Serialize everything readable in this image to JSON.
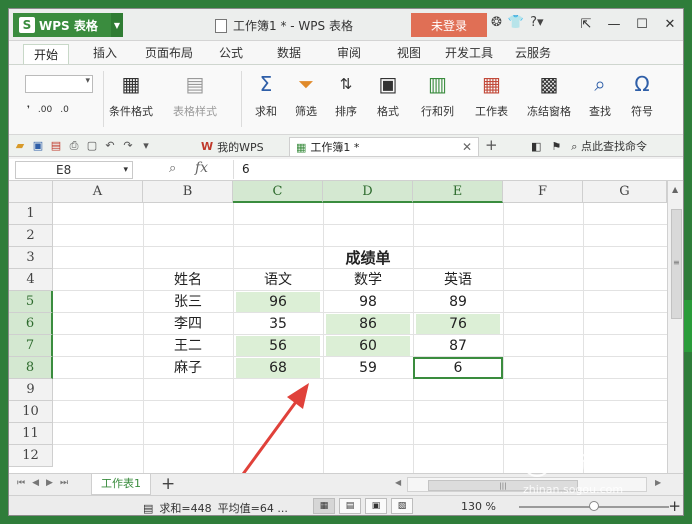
{
  "titlebar": {
    "app_name": "WPS 表格",
    "app_logo": "S",
    "doc_title": "工作簿1 * - WPS 表格",
    "login_label": "未登录",
    "icons": [
      "skin-icon",
      "shirt-icon",
      "help-icon"
    ],
    "help_glyph": "?",
    "window_controls": [
      "minimize-icon",
      "restore-icon",
      "close-icon"
    ]
  },
  "menu": {
    "tabs": [
      "开始",
      "插入",
      "页面布局",
      "公式",
      "数据",
      "审阅",
      "视图",
      "开发工具",
      "云服务"
    ],
    "active": "开始"
  },
  "ribbon": {
    "format_glyphs": [
      ".00",
      ".0"
    ],
    "buttons": [
      {
        "label": "条件格式",
        "icon": "conditional-format-icon"
      },
      {
        "label": "表格样式",
        "icon": "table-style-icon",
        "disabled": true
      },
      {
        "label": "求和",
        "icon": "sum-icon",
        "glyph": "Σ"
      },
      {
        "label": "筛选",
        "icon": "filter-icon"
      },
      {
        "label": "排序",
        "icon": "sort-icon"
      },
      {
        "label": "格式",
        "icon": "format-icon"
      },
      {
        "label": "行和列",
        "icon": "row-column-icon"
      },
      {
        "label": "工作表",
        "icon": "worksheet-icon"
      },
      {
        "label": "冻结窗格",
        "icon": "freeze-panes-icon"
      },
      {
        "label": "查找",
        "icon": "find-icon"
      },
      {
        "label": "符号",
        "icon": "symbol-icon",
        "glyph": "Ω"
      }
    ]
  },
  "quickbar": {
    "mywps_label": "我的WPS",
    "book_tab_label": "工作簿1 *",
    "search_label": "点此查找命令"
  },
  "formula_bar": {
    "name_box": "E8",
    "fx_label": "fx",
    "value": "6"
  },
  "grid": {
    "columns": [
      "A",
      "B",
      "C",
      "D",
      "E",
      "F",
      "G"
    ],
    "rows": [
      "1",
      "2",
      "3",
      "4",
      "5",
      "6",
      "7",
      "8",
      "9",
      "10",
      "11",
      "12"
    ],
    "selected_columns": [
      "C",
      "D",
      "E"
    ],
    "selected_rows": [
      "5",
      "6",
      "7",
      "8"
    ],
    "title": "成绩单",
    "headers": [
      "姓名",
      "语文",
      "数学",
      "英语"
    ],
    "records": [
      {
        "name": "张三",
        "chinese": "96",
        "math": "98",
        "english": "89"
      },
      {
        "name": "李四",
        "chinese": "35",
        "math": "86",
        "english": "76"
      },
      {
        "name": "王二",
        "chinese": "56",
        "math": "60",
        "english": "87"
      },
      {
        "name": "麻子",
        "chinese": "68",
        "math": "59",
        "english": "6"
      }
    ],
    "active_cell": "E8"
  },
  "sheets": {
    "tabs": [
      "工作表1"
    ],
    "active": "工作表1"
  },
  "statusbar": {
    "sum": "求和=448",
    "average": "平均值=64 ...",
    "zoom": "130 %"
  },
  "watermark": {
    "name": "搜狗指南",
    "url": "zhinan.sogou.com"
  },
  "colors": {
    "accent": "#3a8c3e",
    "highlight": "#dcefd6",
    "login": "#e06f55",
    "arrow": "#e0413a"
  }
}
